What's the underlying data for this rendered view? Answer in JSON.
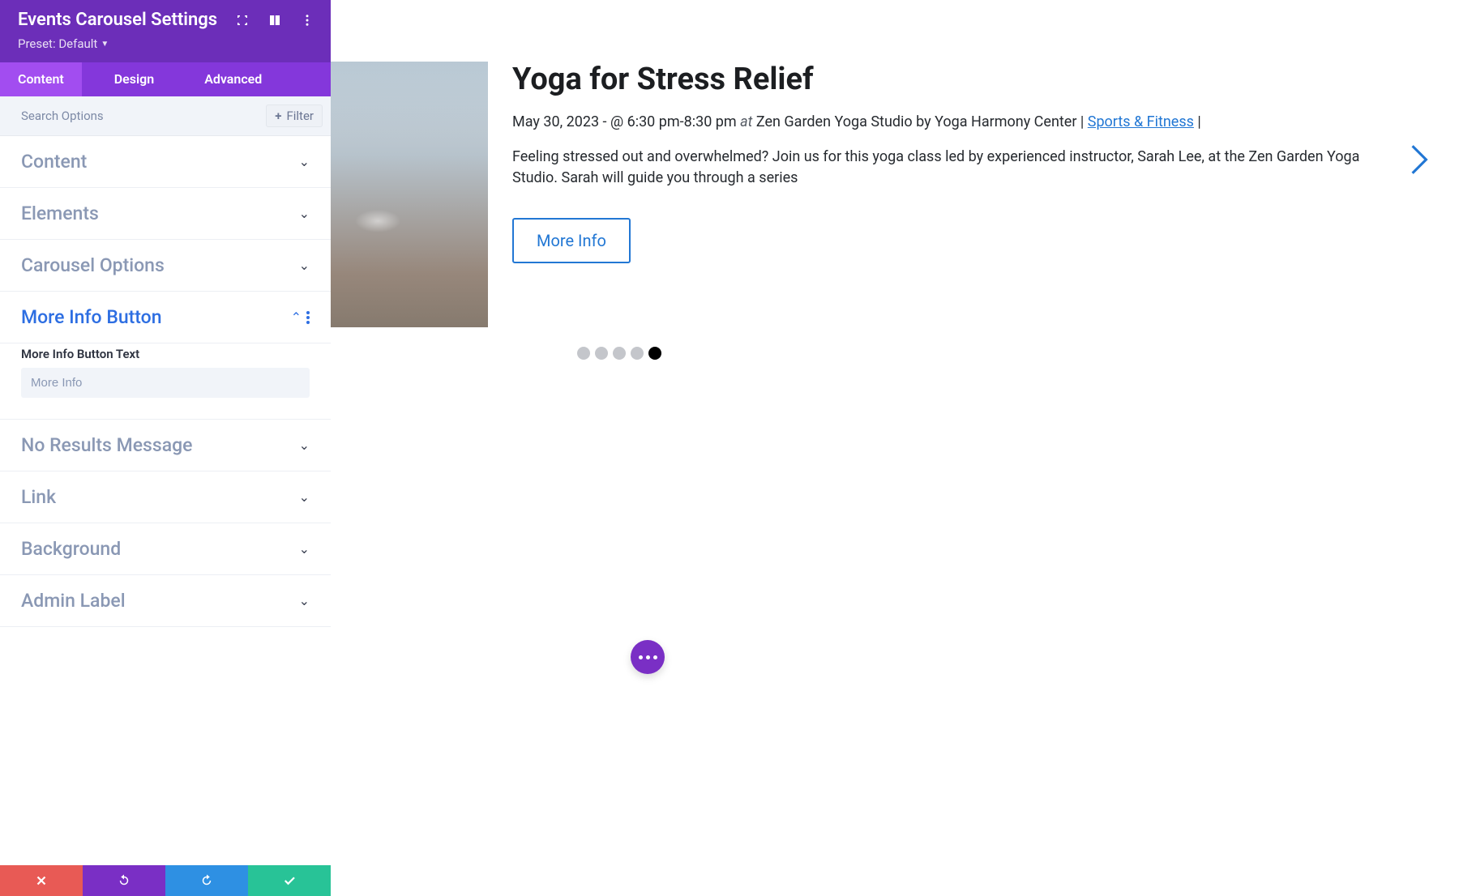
{
  "panel": {
    "title": "Events Carousel Settings",
    "preset_label": "Preset: Default",
    "tabs": {
      "content": "Content",
      "design": "Design",
      "advanced": "Advanced"
    },
    "search_placeholder": "Search Options",
    "filter_label": "Filter",
    "sections": {
      "content": "Content",
      "elements": "Elements",
      "carousel_options": "Carousel Options",
      "more_info_button": "More Info Button",
      "no_results": "No Results Message",
      "link": "Link",
      "background": "Background",
      "admin_label": "Admin Label"
    },
    "more_info_field_label": "More Info Button Text",
    "more_info_field_value": "More Info"
  },
  "event": {
    "title": "Yoga for Stress Relief",
    "date_part": "May 30, 2023 - @ 6:30 pm-8:30 pm ",
    "at": "at",
    "venue_part": " Zen Garden Yoga Studio by Yoga Harmony Center | ",
    "category": "Sports & Fitness",
    "trailing": " |",
    "description": "Feeling stressed out and overwhelmed? Join us for this yoga class led by experienced instructor, Sarah Lee, at the Zen Garden Yoga Studio. Sarah will guide you through a series",
    "button_label": "More Info"
  },
  "carousel": {
    "dot_count": 5,
    "active_dot": 4
  }
}
